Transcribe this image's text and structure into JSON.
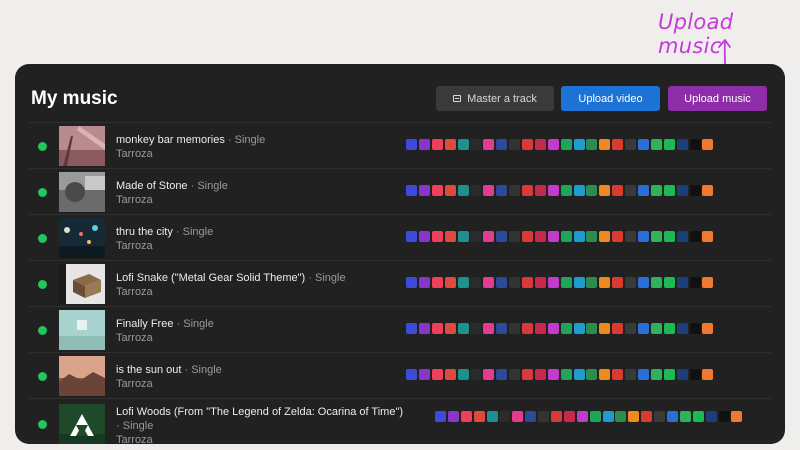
{
  "annotation": "Upload music",
  "title": "My music",
  "buttons": {
    "master": "Master a track",
    "upload_video": "Upload video",
    "upload_music": "Upload music"
  },
  "colors": {
    "status_live": "#22c55e",
    "upload_video": "#1d72d6",
    "upload_music": "#8d2da8",
    "annotation": "#c33bd8"
  },
  "separator": " · ",
  "platform_colors": [
    "#3d4bd9",
    "#8b34c9",
    "#ef3f5d",
    "#e04a3e",
    "#1f8f8f",
    "#2b2b2b",
    "#e23c8e",
    "#2b4a9a",
    "#333333",
    "#d83a3a",
    "#c8284d",
    "#c23cc9",
    "#1ea45b",
    "#1f9bd0",
    "#2c8d4c",
    "#f08a1c",
    "#d93b2f",
    "#3a3a3a",
    "#2a6fd6",
    "#2eb35c",
    "#1db954",
    "#1c3f7a",
    "#111111",
    "#ef7a2f"
  ],
  "tracks": [
    {
      "name": "monkey bar memories",
      "type": "Single",
      "artist": "Tarroza"
    },
    {
      "name": "Made of Stone",
      "type": "Single",
      "artist": "Tarroza"
    },
    {
      "name": "thru the city",
      "type": "Single",
      "artist": "Tarroza"
    },
    {
      "name": "Lofi Snake (\"Metal Gear Solid Theme\")",
      "type": "Single",
      "artist": "Tarroza"
    },
    {
      "name": "Finally Free",
      "type": "Single",
      "artist": "Tarroza"
    },
    {
      "name": "is the sun out",
      "type": "Single",
      "artist": "Tarroza"
    },
    {
      "name": "Lofi Woods (From \"The Legend of Zelda: Ocarina of Time\")",
      "type": "Single",
      "artist": "Tarroza"
    }
  ]
}
